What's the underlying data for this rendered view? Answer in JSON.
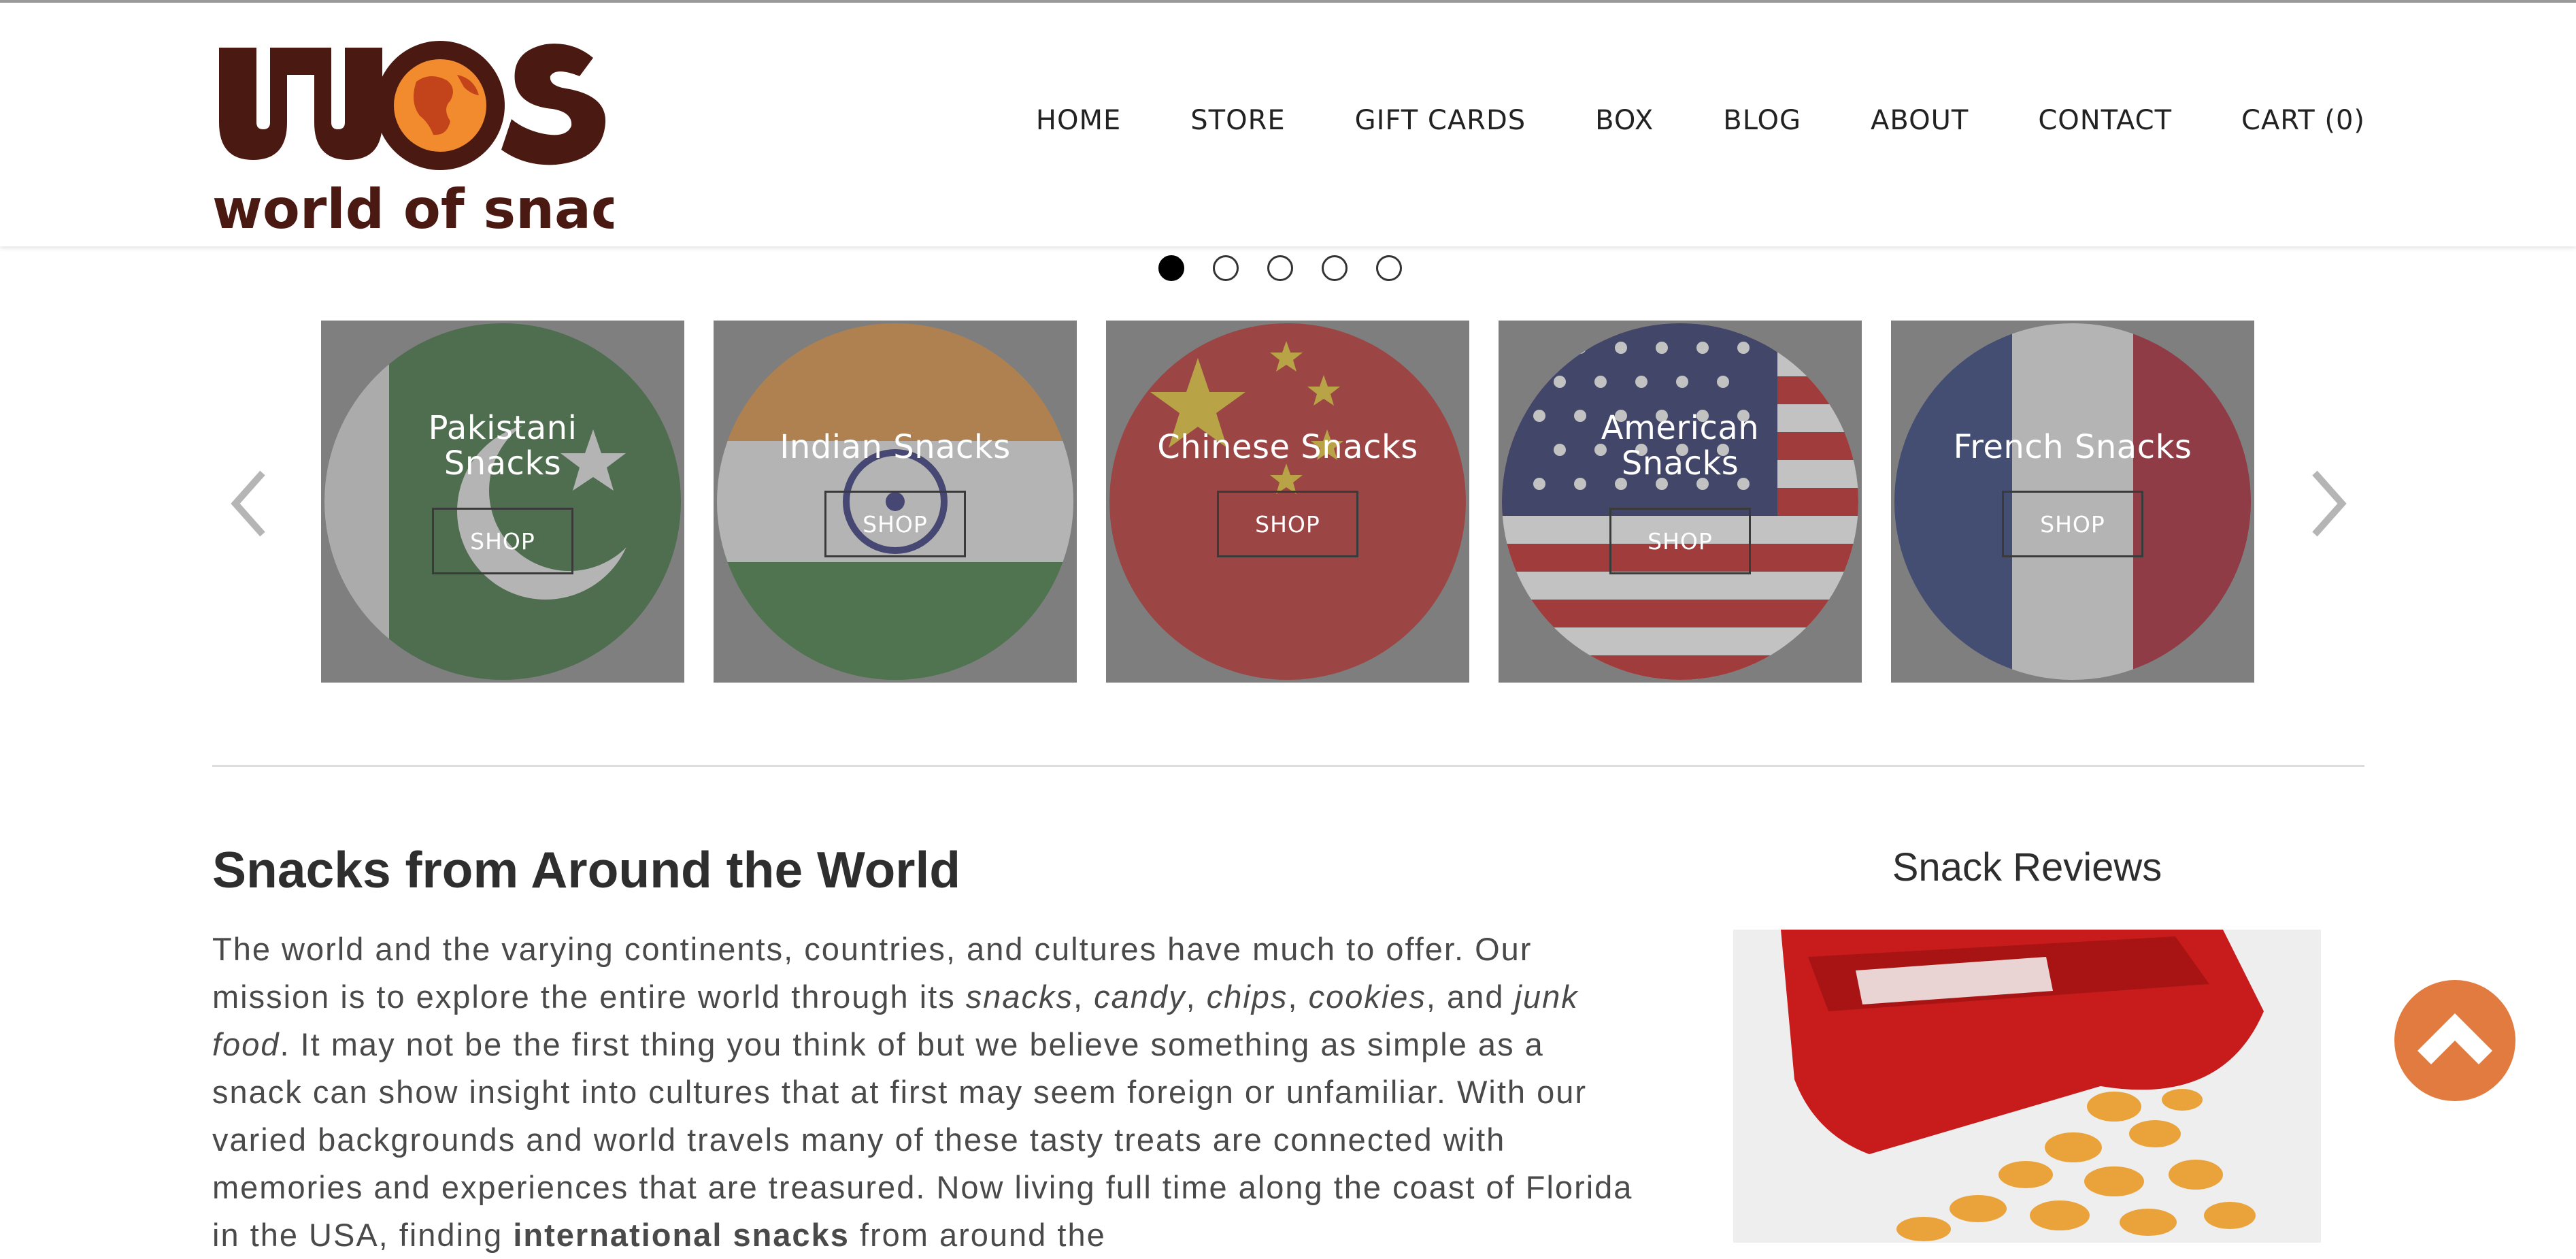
{
  "brand": {
    "logo_letters": "WOS",
    "logo_subtitle": "world of snacks"
  },
  "nav": {
    "home": "HOME",
    "store": "STORE",
    "gift_cards": "GIFT CARDS",
    "box": "BOX",
    "blog": "BLOG",
    "about": "ABOUT",
    "contact": "CONTACT",
    "cart": "CART (0)"
  },
  "carousel": {
    "slides_total": 5,
    "active_slide": 1,
    "cards": [
      {
        "title_line1": "Pakistani",
        "title_line2": "Snacks",
        "shop": "SHOP",
        "flag": "pakistan-flag-icon"
      },
      {
        "title_line1": "Indian Snacks",
        "title_line2": "",
        "shop": "SHOP",
        "flag": "india-flag-icon"
      },
      {
        "title_line1": "Chinese Snacks",
        "title_line2": "",
        "shop": "SHOP",
        "flag": "china-flag-icon"
      },
      {
        "title_line1": "American",
        "title_line2": "Snacks",
        "shop": "SHOP",
        "flag": "usa-flag-icon"
      },
      {
        "title_line1": "French Snacks",
        "title_line2": "",
        "shop": "SHOP",
        "flag": "france-flag-icon"
      }
    ]
  },
  "main": {
    "heading": "Snacks from Around the World",
    "intro_parts": {
      "p1": "The world and the varying continents, countries, and cultures have much to offer.  Our mission is to explore the entire world through its ",
      "snacks": "snacks",
      "comma1": ", ",
      "candy": "candy",
      "comma2": ", ",
      "chips": "chips",
      "comma3": ", ",
      "cookies": "cookies",
      "and": ", and ",
      "junk_food": "junk food",
      "p2": ".  It may not be the first thing you think of but we believe something as simple as a snack can show insight into cultures that at first may seem foreign or unfamiliar.  With our varied backgrounds and world travels many of these tasty treats are connected with memories and experiences that are treasured.  Now living full time along the coast of Florida in the USA, finding ",
      "international_snacks": "international snacks",
      "p3": " from around the"
    }
  },
  "sidebar": {
    "reviews_title": "Snack Reviews",
    "image_icon": "cheese-puffs-bag-photo"
  },
  "colors": {
    "logo_brown": "#4a1a12",
    "accent_orange": "#e27b3f",
    "card_overlay": "#7f7f7f"
  },
  "icons": {
    "prev": "chevron-left-icon",
    "next": "chevron-right-icon",
    "back_to_top": "chevron-up-icon"
  }
}
